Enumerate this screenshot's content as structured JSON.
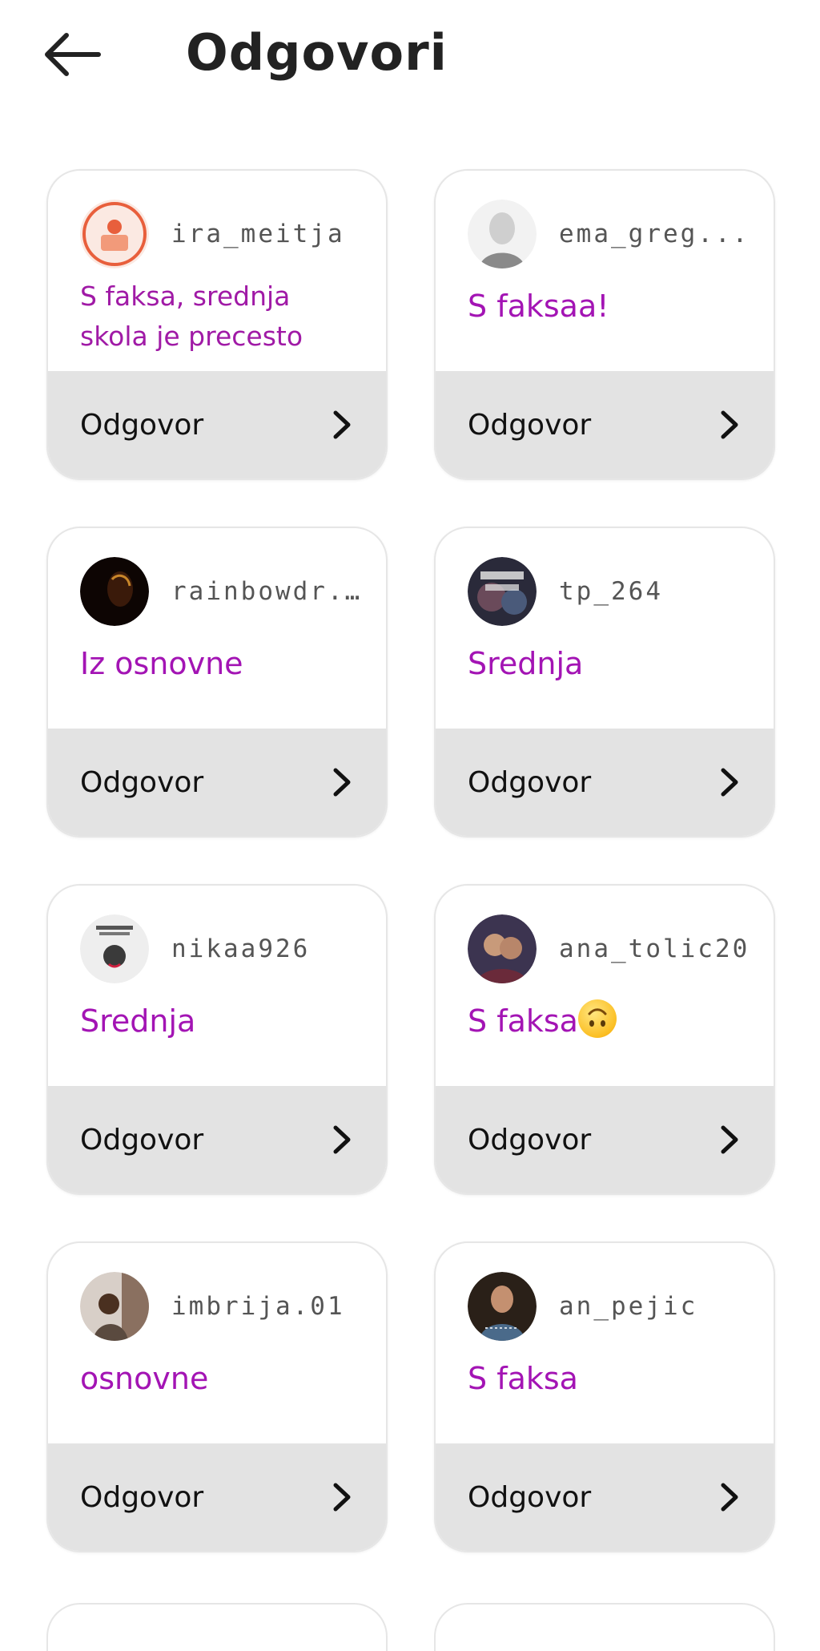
{
  "header": {
    "title": "Odgovori"
  },
  "cards": [
    {
      "username": "ira_meitja",
      "answer": "S faksa, srednja skola je precesto",
      "reply_label": "Odgovor",
      "avatar_color": "#e85f3c"
    },
    {
      "username": "ema_greg...",
      "answer": "S faksaa!",
      "reply_label": "Odgovor",
      "avatar_color": "#b5b5b5"
    },
    {
      "username": "rainbowdr...",
      "answer": "Iz osnovne",
      "reply_label": "Odgovor",
      "avatar_color": "#1a0a05"
    },
    {
      "username": "tp_264",
      "answer": "Srednja",
      "reply_label": "Odgovor",
      "avatar_color": "#3a3a4a"
    },
    {
      "username": "nikaa926",
      "answer": "Srednja",
      "reply_label": "Odgovor",
      "avatar_color": "#dddddd"
    },
    {
      "username": "ana_tolic20",
      "answer": "S faksa",
      "reply_label": "Odgovor",
      "avatar_color": "#5a4a6a",
      "emoji": "upside-down-face"
    },
    {
      "username": "imbrija.01",
      "answer": "osnovne",
      "reply_label": "Odgovor",
      "avatar_color": "#6b5a4f"
    },
    {
      "username": "an_pejic",
      "answer": "S faksa",
      "reply_label": "Odgovor",
      "avatar_color": "#4a5a6a"
    }
  ],
  "colors": {
    "answer_text": "#a314b4",
    "card_footer": "#e3e3e3",
    "card_border": "#e6e6e6"
  }
}
